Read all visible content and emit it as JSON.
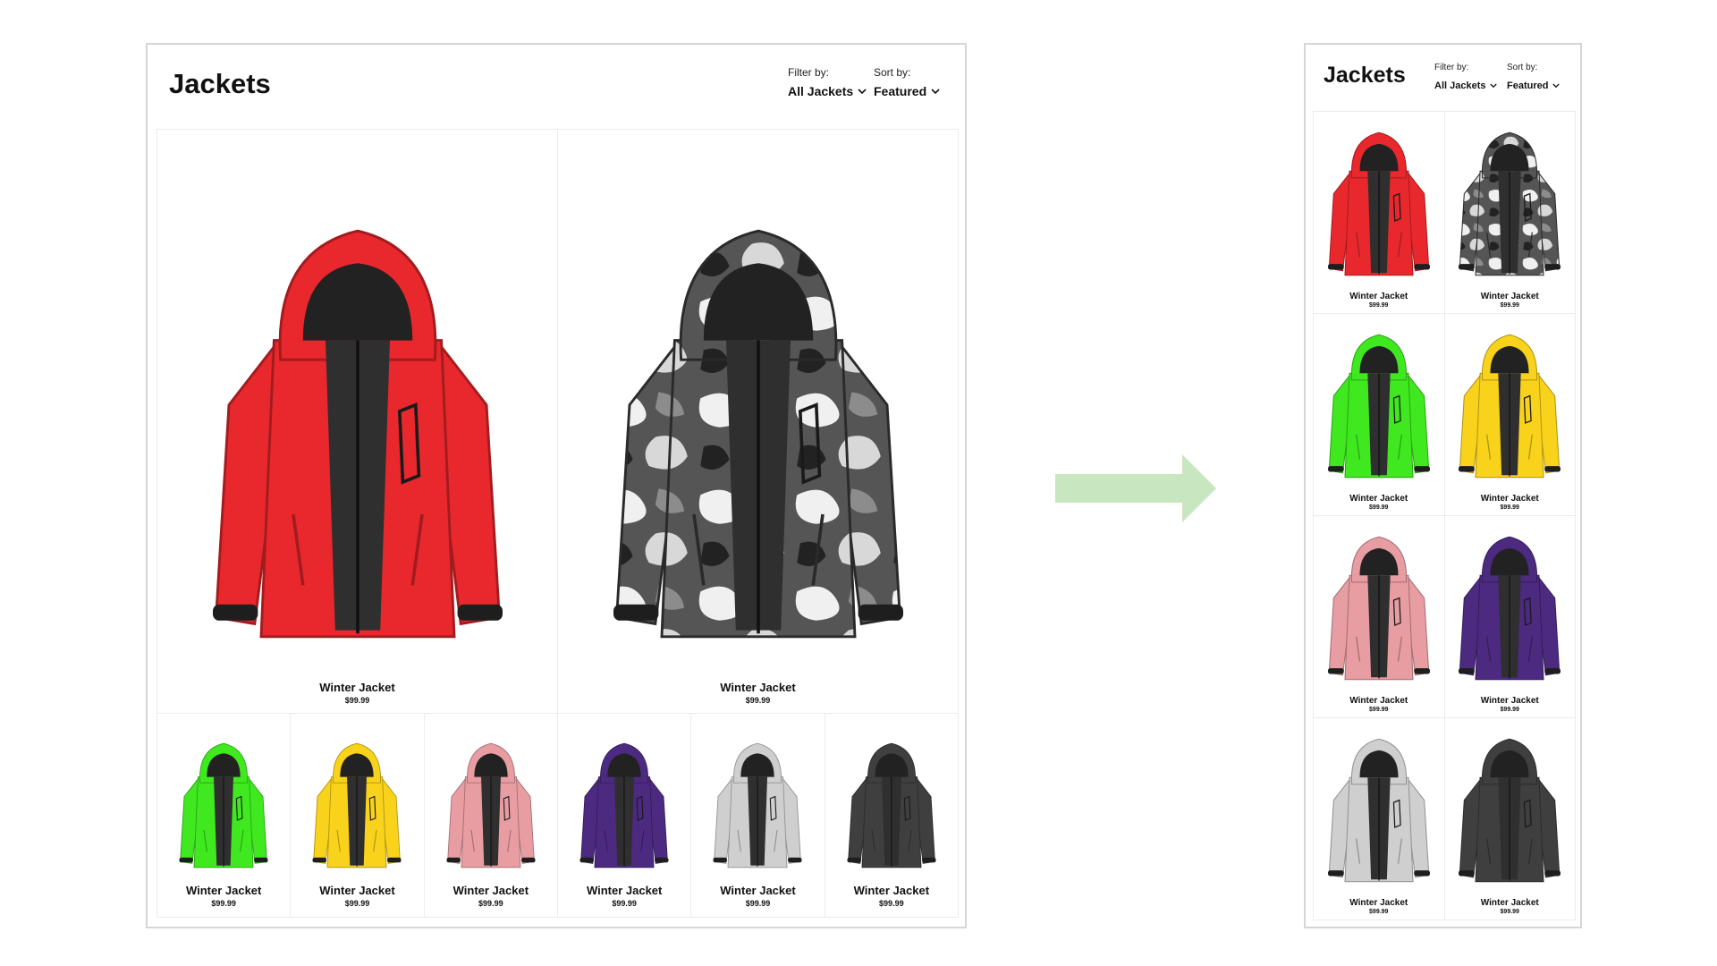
{
  "page_title": "Jackets",
  "filter": {
    "label": "Filter by:",
    "value": "All Jackets"
  },
  "sort": {
    "label": "Sort by:",
    "value": "Featured"
  },
  "products": [
    {
      "name": "Winter Jacket",
      "price": "$99.99",
      "color": "#e8282c",
      "pattern": "solid"
    },
    {
      "name": "Winter Jacket",
      "price": "$99.99",
      "color": "#3c3c3c",
      "pattern": "camo"
    },
    {
      "name": "Winter Jacket",
      "price": "$99.99",
      "color": "#3fe81f",
      "pattern": "solid"
    },
    {
      "name": "Winter Jacket",
      "price": "$99.99",
      "color": "#f8d21b",
      "pattern": "solid"
    },
    {
      "name": "Winter Jacket",
      "price": "$99.99",
      "color": "#e79da2",
      "pattern": "solid"
    },
    {
      "name": "Winter Jacket",
      "price": "$99.99",
      "color": "#4b2a80",
      "pattern": "solid"
    },
    {
      "name": "Winter Jacket",
      "price": "$99.99",
      "color": "#cfcfcf",
      "pattern": "solid"
    },
    {
      "name": "Winter Jacket",
      "price": "$99.99",
      "color": "#3f3f3f",
      "pattern": "solid"
    }
  ],
  "icons": {
    "dropdown": "chevron-down-icon",
    "transition": "arrow-right-icon"
  },
  "colors": {
    "arrow": "#c8e6c0",
    "border": "#d6d6d6",
    "divider": "#ececec"
  }
}
